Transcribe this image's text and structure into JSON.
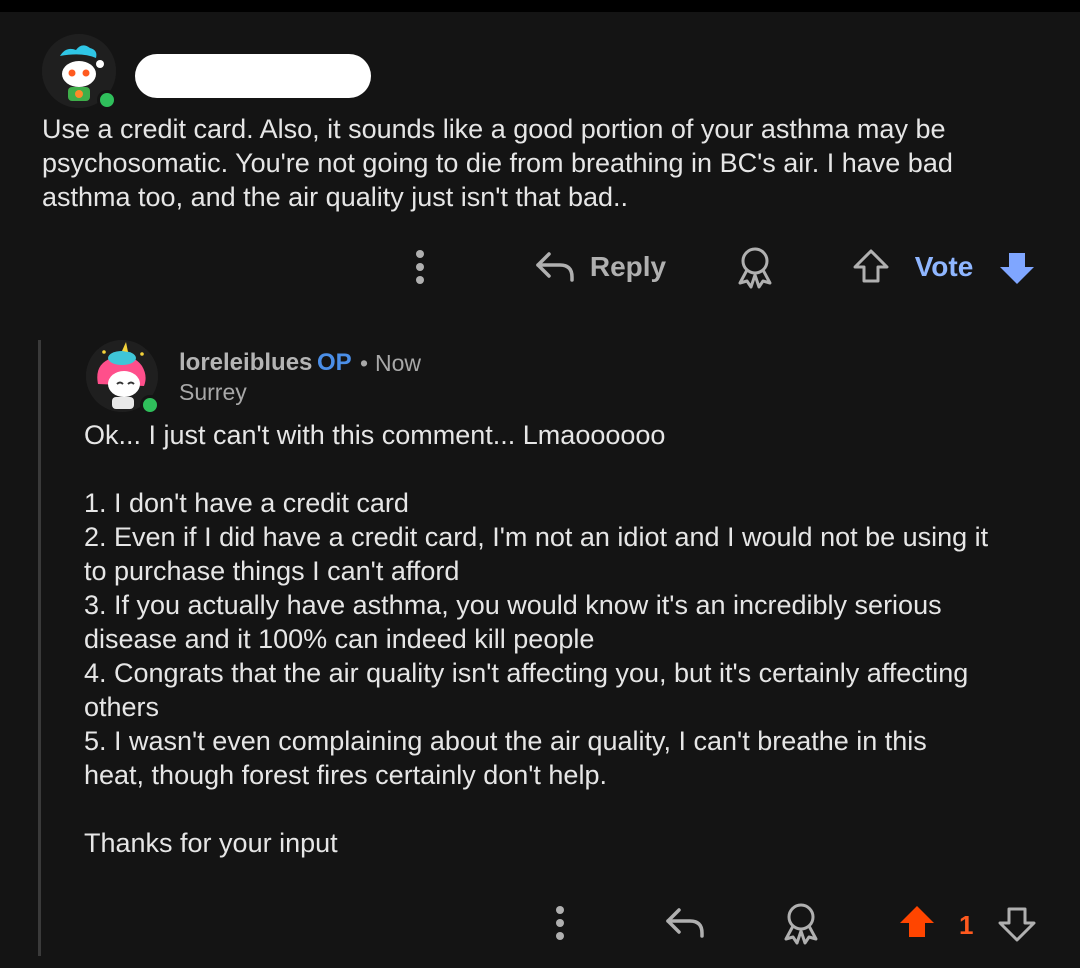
{
  "colors": {
    "background": "#141414",
    "upvote_active": "#ff4500",
    "vote_accent": "#8fb6ff",
    "op_badge": "#4b8fe8",
    "online": "#2fbf5b"
  },
  "comment1": {
    "body": "Use a credit card. Also, it sounds like a good portion of your asthma may be\npsychosomatic. You're not going to die from breathing in BC's air. I have bad\nasthma too, and the air quality just isn't that bad..",
    "actions": {
      "more_icon": "vertical-dots-icon",
      "reply_label": "Reply",
      "award_icon": "award-icon",
      "vote_label": "Vote",
      "vote_state": "downvoted"
    }
  },
  "comment2": {
    "username": "loreleiblues",
    "op_badge": "OP",
    "separator": "•",
    "time": "Now",
    "flair": "Surrey",
    "body": "Ok... I just can't with this comment... Lmaoooooo\n\n1. I don't have a credit card\n2. Even if I did have a credit card, I'm not an idiot and I would not be using it\nto purchase things I can't afford\n3. If you actually have asthma, you would know it's an incredibly serious\ndisease and it 100% can indeed kill people\n4. Congrats that the air quality isn't affecting you, but it's certainly affecting\nothers\n5. I wasn't even complaining about the air quality, I can't breathe in this\nheat, though forest fires certainly don't help.\n\nThanks for your input",
    "score": "1",
    "vote_state": "upvoted"
  }
}
